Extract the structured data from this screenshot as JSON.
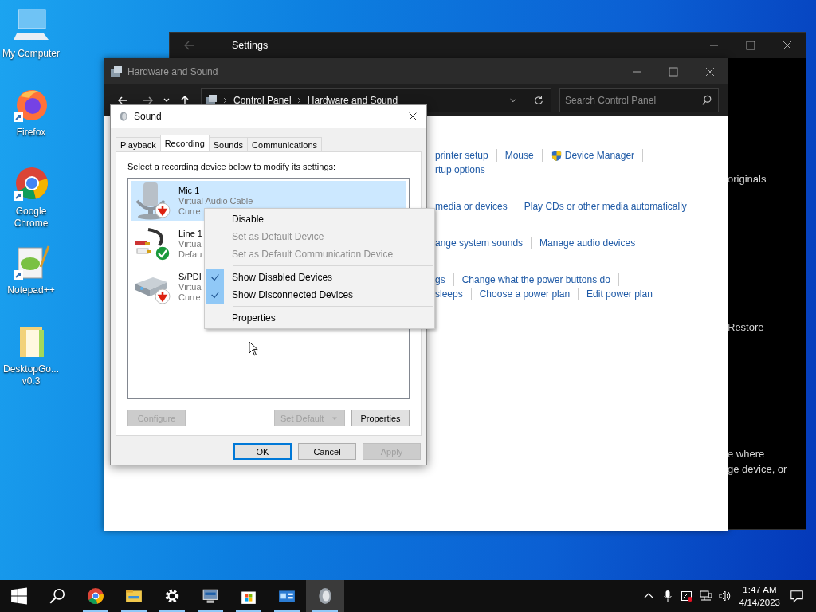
{
  "desktop_icons": [
    {
      "label": "My Computer",
      "kind": "computer",
      "shortcut": false
    },
    {
      "label": "Firefox",
      "kind": "firefox",
      "shortcut": true
    },
    {
      "label": "Google Chrome",
      "kind": "chrome",
      "shortcut": true
    },
    {
      "label": "Notepad++",
      "kind": "notepad",
      "shortcut": true
    },
    {
      "label": "DesktopGo... v0.3",
      "kind": "folder",
      "shortcut": false
    }
  ],
  "settings_window": {
    "title": "Settings",
    "texts": [
      "originals",
      "Restore",
      "e where",
      "ge device, or"
    ]
  },
  "control_panel": {
    "title": "Hardware and Sound",
    "breadcrumb": [
      "Control Panel",
      "Hardware and Sound"
    ],
    "search": {
      "placeholder": "Search Control Panel"
    },
    "sections": [
      [
        [
          {
            "text": "printer setup",
            "shield": false,
            "bar_after": true
          },
          {
            "text": "Mouse",
            "shield": false,
            "bar_after": true
          },
          {
            "text": "Device Manager",
            "shield": true,
            "bar_after": true
          }
        ],
        [
          {
            "text": "rtup options",
            "shield": false,
            "bar_after": false
          }
        ]
      ],
      [
        [
          {
            "text": "media or devices",
            "shield": false,
            "bar_after": true
          },
          {
            "text": "Play CDs or other media automatically",
            "shield": false,
            "bar_after": false
          }
        ]
      ],
      [
        [
          {
            "text": "ange system sounds",
            "shield": false,
            "bar_after": true
          },
          {
            "text": "Manage audio devices",
            "shield": false,
            "bar_after": false
          }
        ]
      ],
      [
        [
          {
            "text": "gs",
            "shield": false,
            "bar_after": true
          },
          {
            "text": "Change what the power buttons do",
            "shield": false,
            "bar_after": true
          }
        ],
        [
          {
            "text": "sleeps",
            "shield": false,
            "bar_after": true
          },
          {
            "text": "Choose a power plan",
            "shield": false,
            "bar_after": true
          },
          {
            "text": "Edit power plan",
            "shield": false,
            "bar_after": false
          }
        ]
      ]
    ]
  },
  "sound_dialog": {
    "title": "Sound",
    "tabs": [
      {
        "label": "Playback",
        "selected": false
      },
      {
        "label": "Recording",
        "selected": true
      },
      {
        "label": "Sounds",
        "selected": false
      },
      {
        "label": "Communications",
        "selected": false
      }
    ],
    "instruction": "Select a recording device below to modify its settings:",
    "devices": [
      {
        "name": "Mic 1",
        "line_2": "Virtual Audio Cable",
        "line_3": "Curre",
        "kind": "microphone",
        "default": false,
        "selected": true
      },
      {
        "name": "Line 1",
        "line_2": "Virtua",
        "line_3": "Defau",
        "kind": "line_in",
        "default": true,
        "selected": false
      },
      {
        "name": "S/PDI",
        "line_2": "Virtua",
        "line_3": "Curre",
        "kind": "spdif",
        "default": false,
        "selected": false
      }
    ],
    "buttons": [
      {
        "label": "Configure",
        "disabled": true,
        "split": false
      },
      {
        "label": "Set Default",
        "disabled": true,
        "split": true
      },
      {
        "label": "Properties",
        "disabled": false,
        "split": false
      }
    ],
    "footer_buttons": [
      {
        "label": "OK",
        "default": true,
        "disabled": false
      },
      {
        "label": "Cancel",
        "default": false,
        "disabled": false
      },
      {
        "label": "Apply",
        "default": false,
        "disabled": true
      }
    ]
  },
  "context_menu": [
    {
      "kind": "item",
      "label": "Disable",
      "disabled": false,
      "checked": false
    },
    {
      "kind": "item",
      "label": "Set as Default Device",
      "disabled": true,
      "checked": false
    },
    {
      "kind": "item",
      "label": "Set as Default Communication Device",
      "disabled": true,
      "checked": false
    },
    {
      "kind": "separator"
    },
    {
      "kind": "item",
      "label": "Show Disabled Devices",
      "disabled": false,
      "checked": true
    },
    {
      "kind": "item",
      "label": "Show Disconnected Devices",
      "disabled": false,
      "checked": true
    },
    {
      "kind": "separator"
    },
    {
      "kind": "item",
      "label": "Properties",
      "disabled": false,
      "checked": false
    }
  ],
  "taskbar": {
    "apps": [
      {
        "kind": "start",
        "running": false,
        "active": false
      },
      {
        "kind": "search",
        "running": false,
        "active": false
      },
      {
        "kind": "chrome",
        "running": true,
        "active": false
      },
      {
        "kind": "explorer",
        "running": true,
        "active": false
      },
      {
        "kind": "settings",
        "running": true,
        "active": false
      },
      {
        "kind": "control_panel",
        "running": true,
        "active": false
      },
      {
        "kind": "store",
        "running": true,
        "active": false
      },
      {
        "kind": "app",
        "running": true,
        "active": false
      },
      {
        "kind": "sound",
        "running": true,
        "active": true
      }
    ],
    "tray": [
      {
        "kind": "caret"
      },
      {
        "kind": "microphone"
      },
      {
        "kind": "app_alert"
      },
      {
        "kind": "network"
      },
      {
        "kind": "volume"
      }
    ],
    "time": "1:47 AM",
    "date": "4/14/2023"
  }
}
